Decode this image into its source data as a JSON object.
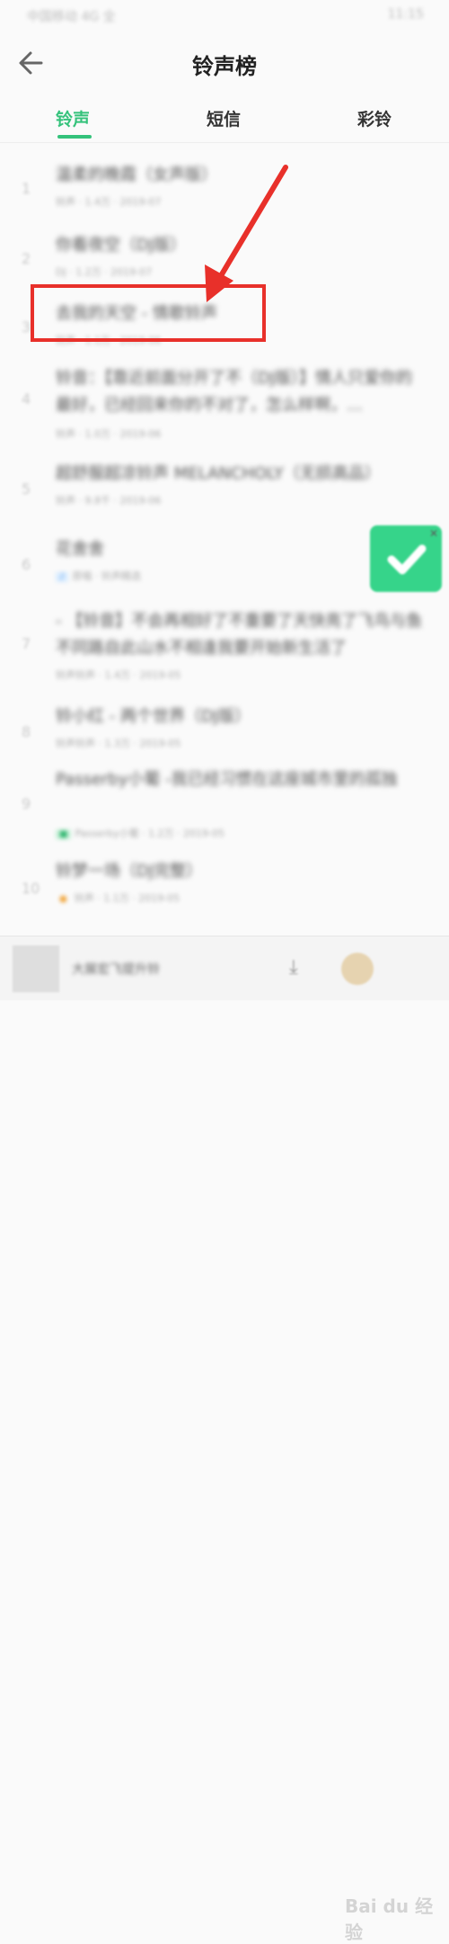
{
  "status_bar": {
    "left": "中国移动 4G 全",
    "right": "11:15"
  },
  "header": {
    "title": "铃声榜"
  },
  "tabs": [
    {
      "label": "铃声",
      "active": true
    },
    {
      "label": "短信",
      "active": false
    },
    {
      "label": "彩铃",
      "active": false
    }
  ],
  "list": [
    {
      "rank": "1",
      "title": "温柔的晚霞（女声版）",
      "meta": "铃声 · 1.4万 · 2019-07"
    },
    {
      "rank": "2",
      "title": "你看夜空（DJ版）",
      "meta": "DJ · 1.2万 · 2019-07"
    },
    {
      "rank": "3",
      "title": "去我的天空 - 情歌铃声",
      "meta": "铃声 · 1.1万 · 2019-06"
    },
    {
      "rank": "4",
      "title": "铃音：【靠近前面分开了不（DJ版）】情人只爱你的最好，已经回来你的不对了，怎么样啊，…",
      "meta": "铃声 · 1.0万 · 2019-06"
    },
    {
      "rank": "5",
      "title": "超舒服超凉铃声 MELANCHOLY（无损高品）",
      "meta": "铃声 · 9.8千 · 2019-06"
    },
    {
      "rank": "6",
      "title": "花舍舍",
      "meta": "原唱 · 铃声精选"
    },
    {
      "rank": "7",
      "title": "- 【铃音】不会再相好了不重要了天快亮了飞鸟与鱼不同路自此山水不相逢我要开始新生活了",
      "meta": "铃声铃声 · 1.4万 · 2019-05"
    },
    {
      "rank": "8",
      "title": "铃小红 - 两个世界（DJ版）",
      "meta": "铃声铃声 · 1.3万 · 2019-05"
    },
    {
      "rank": "9",
      "title": "Passerby小葡 -我已经习惯在这座城市里的孤独",
      "meta": "Passerby小葡 · 1.2万 · 2019-05"
    },
    {
      "rank": "10",
      "title": "铃梦一场（DJ完整）",
      "meta": "铃声 · 1.1万 · 2019-05"
    }
  ],
  "player": {
    "title": "大展宏飞提升铃",
    "watermark": "Bai du 经验"
  }
}
